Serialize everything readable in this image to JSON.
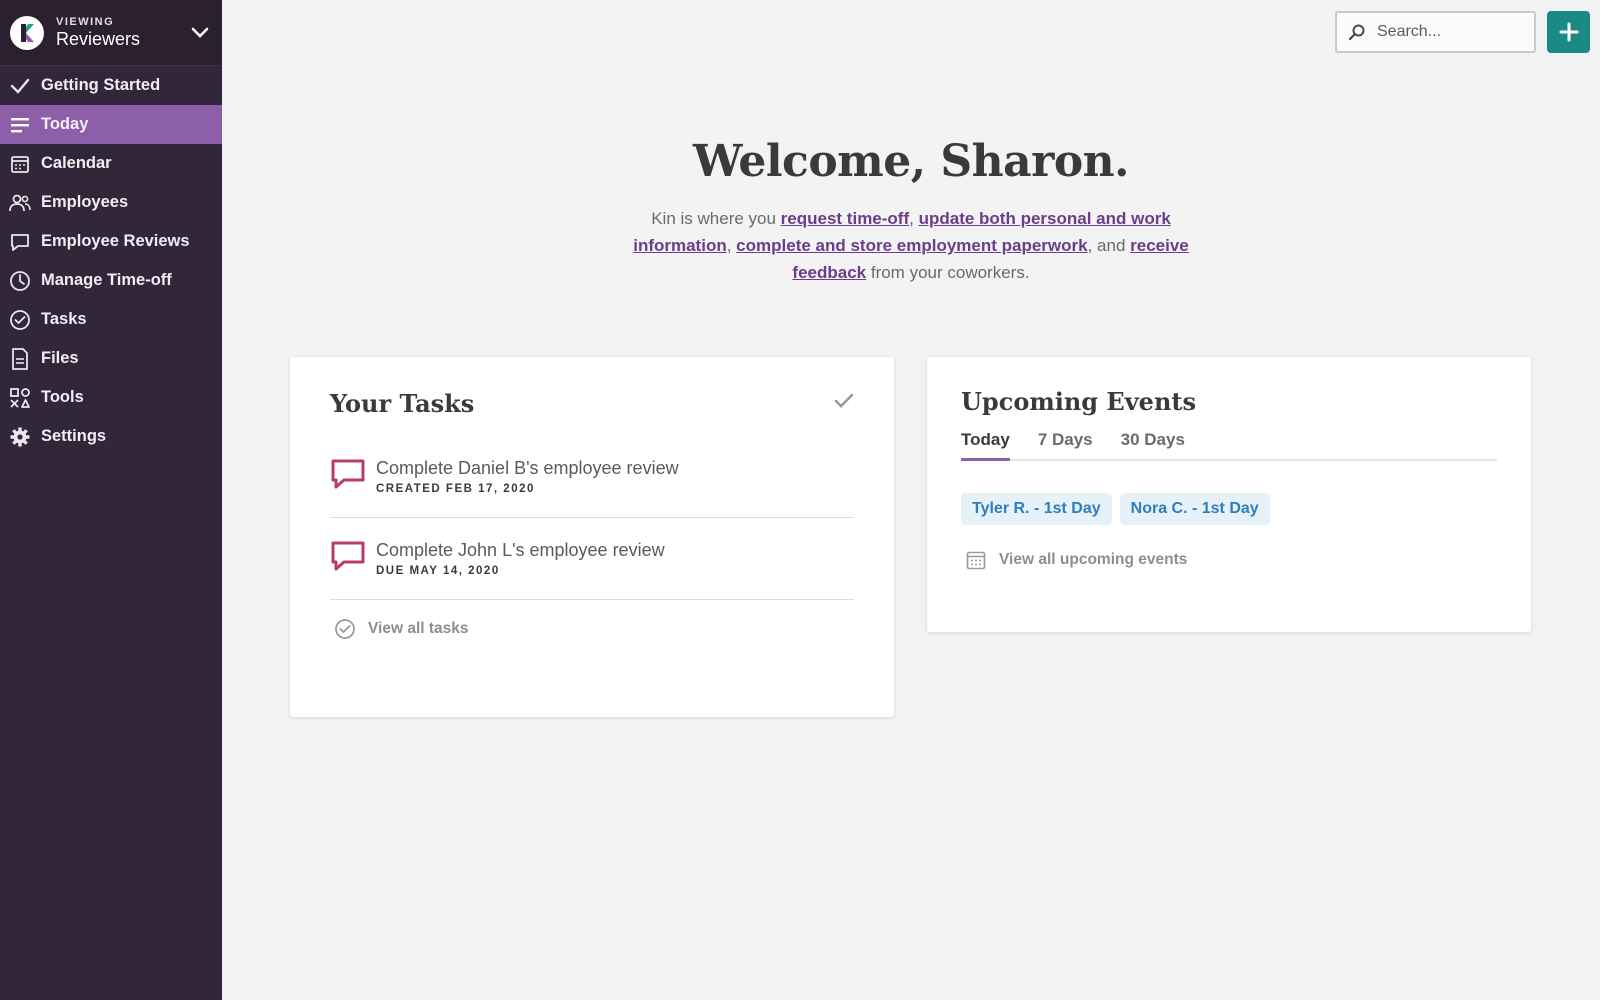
{
  "sidebar": {
    "eyebrow": "VIEWING",
    "title": "Reviewers",
    "items": [
      {
        "label": "Getting Started",
        "icon": "check-icon"
      },
      {
        "label": "Today",
        "icon": "lines-icon",
        "active": true
      },
      {
        "label": "Calendar",
        "icon": "calendar-icon"
      },
      {
        "label": "Employees",
        "icon": "people-icon"
      },
      {
        "label": "Employee Reviews",
        "icon": "chat-icon"
      },
      {
        "label": "Manage Time-off",
        "icon": "clock-icon"
      },
      {
        "label": "Tasks",
        "icon": "check-circle-icon"
      },
      {
        "label": "Files",
        "icon": "file-icon"
      },
      {
        "label": "Tools",
        "icon": "tools-icon"
      },
      {
        "label": "Settings",
        "icon": "gear-icon"
      }
    ]
  },
  "search": {
    "placeholder": "Search..."
  },
  "colors": {
    "sidebar": "#32263a",
    "active": "#8d5fa8",
    "accent": "#1c8a84",
    "link": "#6b3d8a",
    "chip": "#2f7fbf",
    "task_icon": "#b83b6f"
  },
  "welcome": {
    "title": "Welcome, Sharon.",
    "intro": "Kin is where you ",
    "link1": "request time-off",
    "sep1": ", ",
    "link2": "update both personal and work information",
    "sep2": ", ",
    "link3": "complete and store employment paperwork",
    "sep3": ", and ",
    "link4": "receive feedback",
    "outro": " from your coworkers."
  },
  "tasks": {
    "title": "Your Tasks",
    "items": [
      {
        "title": "Complete Daniel B's employee review",
        "meta": "CREATED FEB 17, 2020"
      },
      {
        "title": "Complete John L's employee review",
        "meta": "DUE MAY 14, 2020"
      }
    ],
    "view_all": "View all tasks"
  },
  "events": {
    "title": "Upcoming Events",
    "tabs": [
      "Today",
      "7 Days",
      "30 Days"
    ],
    "chips": [
      "Tyler R. - 1st Day",
      "Nora C. - 1st Day"
    ],
    "view_all": "View all upcoming events"
  }
}
